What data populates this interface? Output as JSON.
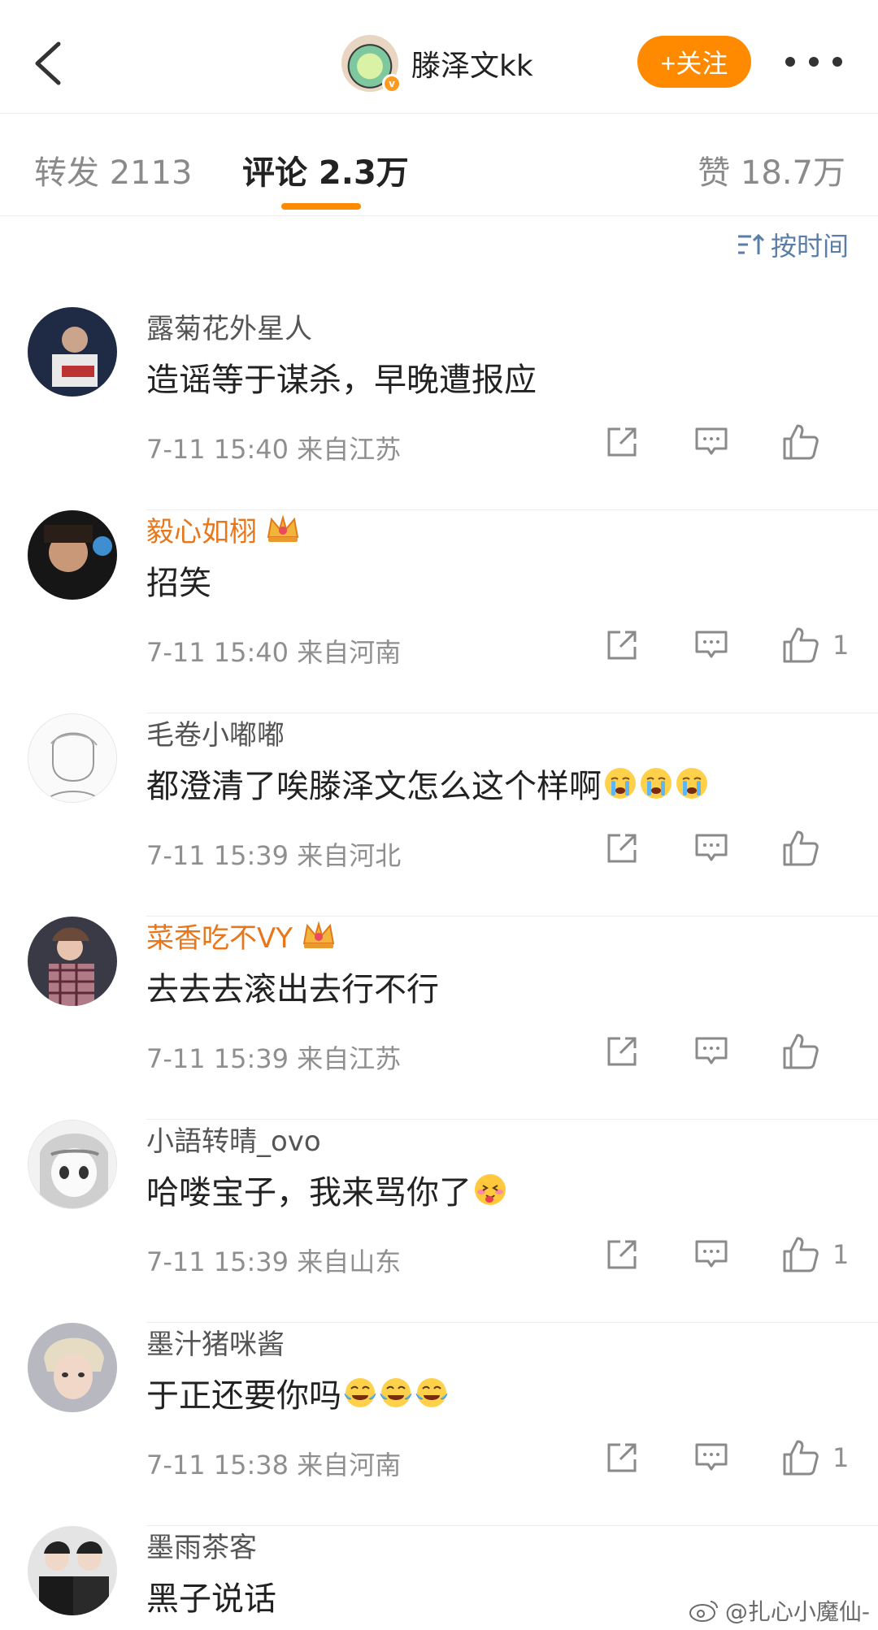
{
  "header": {
    "username": "滕泽文kk",
    "follow_label": "+关注",
    "verified_mark": "v"
  },
  "tabs": [
    {
      "label": "转发 2113",
      "active": false
    },
    {
      "label": "评论 2.3万",
      "active": true
    },
    {
      "label": "赞 18.7万",
      "active": false
    }
  ],
  "sort_label": "按时间",
  "colors": {
    "accent": "#ff8a00",
    "vip_name": "#e8761a",
    "link_blue": "#5a7ea8"
  },
  "comments": [
    {
      "name": "露菊花外星人",
      "vip": false,
      "text": "造谣等于谋杀，早晚遭报应",
      "emojis": [],
      "time": "7-11 15:40",
      "location": "来自江苏",
      "likes": ""
    },
    {
      "name": "毅心如栩",
      "vip": true,
      "text": "招笑",
      "emojis": [],
      "time": "7-11 15:40",
      "location": "来自河南",
      "likes": "1"
    },
    {
      "name": "毛卷小嘟嘟",
      "vip": false,
      "text": "都澄清了唉滕泽文怎么这个样啊",
      "emojis": [
        "crying-emoji",
        "crying-emoji",
        "crying-emoji"
      ],
      "time": "7-11 15:39",
      "location": "来自河北",
      "likes": ""
    },
    {
      "name": "菜香吃不VY",
      "vip": true,
      "text": "去去去滚出去行不行",
      "emojis": [],
      "time": "7-11 15:39",
      "location": "来自江苏",
      "likes": ""
    },
    {
      "name": "小語转晴_ovo",
      "vip": false,
      "text": "哈喽宝子，我来骂你了",
      "emojis": [
        "tongue-emoji"
      ],
      "time": "7-11 15:39",
      "location": "来自山东",
      "likes": "1"
    },
    {
      "name": "墨汁猪咪酱",
      "vip": false,
      "text": "于正还要你吗",
      "emojis": [
        "tears-of-joy-emoji",
        "tears-of-joy-emoji",
        "tears-of-joy-emoji"
      ],
      "time": "7-11 15:38",
      "location": "来自河南",
      "likes": "1"
    },
    {
      "name": "墨雨茶客",
      "vip": false,
      "text": "黑子说话",
      "emojis": [],
      "time": "",
      "location": "",
      "likes": ""
    }
  ],
  "watermark": "@扎心小魔仙-"
}
